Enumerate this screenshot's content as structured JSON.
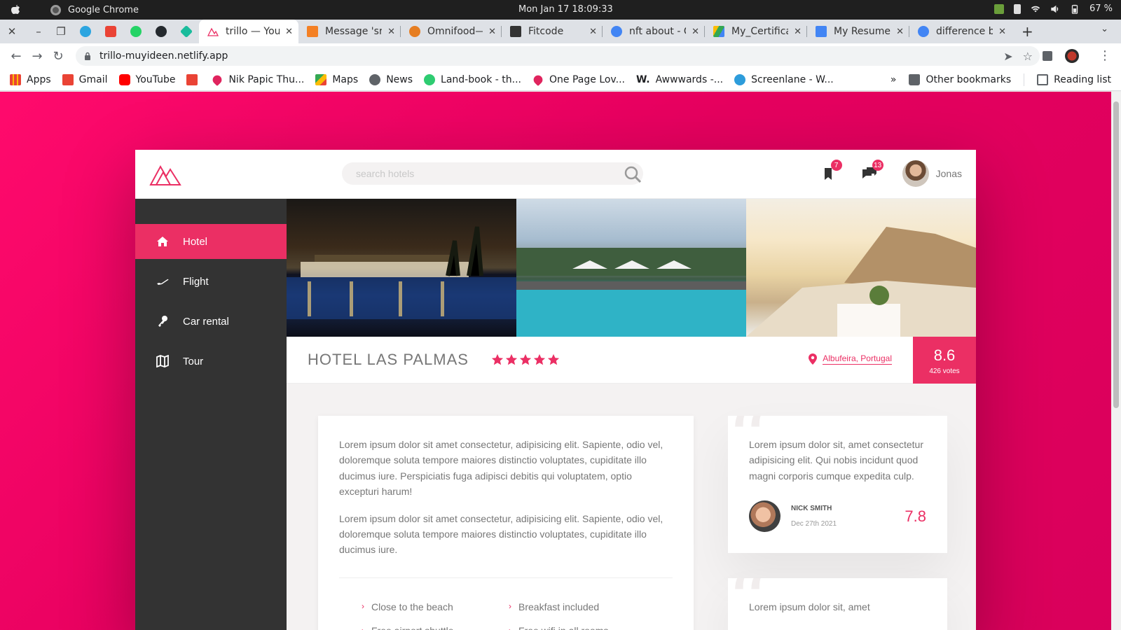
{
  "os": {
    "app_name": "Google Chrome",
    "clock": "Mon Jan 17  18:09:33",
    "battery": "67 %"
  },
  "tabs": [
    {
      "title": "trillo — Your",
      "active": true,
      "favicon_color": "#eb2f64"
    },
    {
      "title": "Message 'sr",
      "active": false,
      "favicon_color": "#f48024"
    },
    {
      "title": "Omnifood—",
      "active": false,
      "favicon_color": "#e67e22"
    },
    {
      "title": "Fitcode",
      "active": false,
      "favicon_color": "#333333"
    },
    {
      "title": "nft about - G",
      "active": false,
      "favicon_color": "#4285f4"
    },
    {
      "title": "My_Certifica",
      "active": false,
      "favicon_color": "#34a853"
    },
    {
      "title": "My Resume",
      "active": false,
      "favicon_color": "#4285f4"
    },
    {
      "title": "difference b",
      "active": false,
      "favicon_color": "#4285f4"
    }
  ],
  "address": {
    "url": "trillo-muyideen.netlify.app"
  },
  "bookmarks": [
    {
      "label": "Apps",
      "icon": "apps-grid-icon",
      "color": "#4285f4"
    },
    {
      "label": "Gmail",
      "icon": "gmail-icon",
      "color": "#ea4335"
    },
    {
      "label": "YouTube",
      "icon": "youtube-icon",
      "color": "#ff0000"
    },
    {
      "label": "",
      "icon": "gmail-icon",
      "color": "#ea4335"
    },
    {
      "label": "Nik Papic Thu...",
      "icon": "heart-icon",
      "color": "#e0245e"
    },
    {
      "label": "Maps",
      "icon": "maps-icon",
      "color": "#34a853"
    },
    {
      "label": "News",
      "icon": "globe-icon",
      "color": "#5f6368"
    },
    {
      "label": "Land-book - th...",
      "icon": "landbook-icon",
      "color": "#2ecc71"
    },
    {
      "label": "One Page Lov...",
      "icon": "heart-icon",
      "color": "#e0245e"
    },
    {
      "label": "Awwwards -...",
      "icon": "awwwards-icon",
      "color": "#222222"
    },
    {
      "label": "Screenlane - W...",
      "icon": "screenlane-icon",
      "color": "#2d9cdb"
    }
  ],
  "bookmarks_right": {
    "more": "»",
    "other": "Other bookmarks",
    "reading": "Reading list"
  },
  "site": {
    "search_placeholder": "search hotels",
    "bookmarks_count": "7",
    "messages_count": "13",
    "user_name": "Jonas",
    "accent_color": "#eb2f64",
    "nav": [
      {
        "label": "Hotel",
        "icon": "home-icon",
        "active": true
      },
      {
        "label": "Flight",
        "icon": "aircraft-icon",
        "active": false
      },
      {
        "label": "Car rental",
        "icon": "key-icon",
        "active": false
      },
      {
        "label": "Tour",
        "icon": "map-icon",
        "active": false
      }
    ],
    "hotel": {
      "name": "HOTEL LAS PALMAS",
      "stars": 5,
      "location": "Albufeira, Portugal",
      "rating": "8.6",
      "votes": "426 votes"
    },
    "description": [
      "Lorem ipsum dolor sit amet consectetur, adipisicing elit. Sapiente, odio vel, doloremque soluta tempore maiores distinctio voluptates, cupiditate illo ducimus iure. Perspiciatis fuga adipisci debitis qui voluptatem, optio excepturi harum!",
      "Lorem ipsum dolor sit amet consectetur, adipisicing elit. Sapiente, odio vel, doloremque soluta tempore maiores distinctio voluptates, cupiditate illo ducimus iure."
    ],
    "features": [
      "Close to the beach",
      "Breakfast included",
      "Free airport shuttle",
      "Free wifi in all rooms"
    ],
    "reviews": [
      {
        "text": "Lorem ipsum dolor sit, amet consectetur adipisicing elit. Qui nobis incidunt quod magni corporis cumque expedita culp.",
        "name": "NICK SMITH",
        "date": "Dec 27th 2021",
        "rating": "7.8"
      },
      {
        "text": "Lorem ipsum dolor sit, amet",
        "name": "",
        "date": "",
        "rating": ""
      }
    ]
  }
}
